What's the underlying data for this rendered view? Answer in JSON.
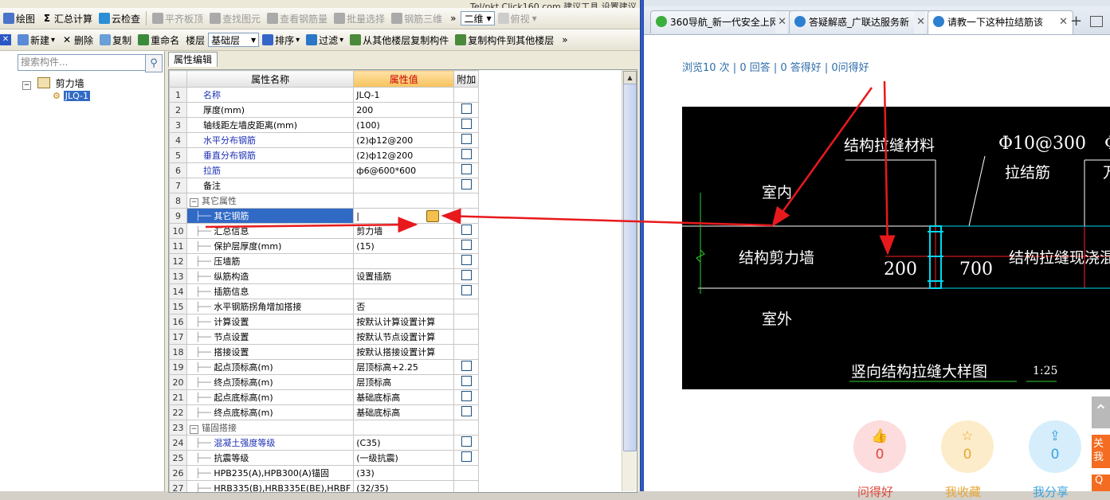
{
  "top_strip": {
    "text": "Tel/pkt.Click160.com    建议工具    设置建议"
  },
  "toolbar1": {
    "items": [
      {
        "label": "绘图",
        "enabled": true,
        "icon": "draw-icon"
      },
      {
        "label": "汇总计算",
        "enabled": true,
        "icon": "sigma-icon",
        "prefix": "Σ"
      },
      {
        "label": "云检查",
        "enabled": true,
        "icon": "cloud-check-icon"
      },
      {
        "label": "平齐板顶",
        "enabled": false,
        "icon": "align-top-icon"
      },
      {
        "label": "查找图元",
        "enabled": false,
        "icon": "find-element-icon"
      },
      {
        "label": "查看钢筋量",
        "enabled": false,
        "icon": "view-rebar-icon"
      },
      {
        "label": "批量选择",
        "enabled": false,
        "icon": "batch-select-icon"
      },
      {
        "label": "钢筋三维",
        "enabled": false,
        "icon": "rebar-3d-icon"
      }
    ],
    "overflow": "»",
    "view_combo": "二维",
    "view_combo2": "俯视"
  },
  "toolbar2": {
    "items": [
      {
        "label": "新建",
        "dropdown": true,
        "icon": "new-icon"
      },
      {
        "label": "删除",
        "icon": "delete-icon",
        "prefix": "✕"
      },
      {
        "label": "复制",
        "icon": "copy-icon"
      },
      {
        "label": "重命名",
        "icon": "rename-icon"
      }
    ],
    "floor_label": "楼层",
    "floor_value": "基础层",
    "items2": [
      {
        "label": "排序",
        "dropdown": true,
        "icon": "sort-icon"
      },
      {
        "label": "过滤",
        "dropdown": true,
        "icon": "filter-icon"
      },
      {
        "label": "从其他楼层复制构件",
        "icon": "copy-from-floor-icon"
      },
      {
        "label": "复制构件到其他楼层",
        "icon": "copy-to-floor-icon"
      }
    ],
    "overflow": "»"
  },
  "tree": {
    "search_placeholder": "搜索构件...",
    "root": "剪力墙",
    "child": "JLQ-1"
  },
  "tab_label": "属性编辑",
  "grid": {
    "headers": {
      "name": "属性名称",
      "value": "属性值",
      "attach": "附加"
    },
    "rows": [
      {
        "n": "1",
        "name": "名称",
        "value": "JLQ-1",
        "style": "blue",
        "chk": false
      },
      {
        "n": "2",
        "name": "厚度(mm)",
        "value": "200",
        "style": "",
        "chk": true
      },
      {
        "n": "3",
        "name": "轴线距左墙皮距离(mm)",
        "value": "(100)",
        "style": "",
        "chk": true
      },
      {
        "n": "4",
        "name": "水平分布钢筋",
        "value": "(2)ф12@200",
        "style": "blue",
        "chk": true
      },
      {
        "n": "5",
        "name": "垂直分布钢筋",
        "value": "(2)ф12@200",
        "style": "blue",
        "chk": true
      },
      {
        "n": "6",
        "name": "拉筋",
        "value": "ф6@600*600",
        "style": "blue",
        "chk": true
      },
      {
        "n": "7",
        "name": "备注",
        "value": "",
        "style": "",
        "chk": true
      },
      {
        "n": "8",
        "name": "其它属性",
        "value": "",
        "style": "group",
        "chk": false,
        "group": true
      },
      {
        "n": "9",
        "name": "其它钢筋",
        "value": "|",
        "style": "sel",
        "chk": false,
        "child": true,
        "ellipsis": true
      },
      {
        "n": "10",
        "name": "汇总信息",
        "value": "剪力墙",
        "style": "",
        "chk": true,
        "child": true
      },
      {
        "n": "11",
        "name": "保护层厚度(mm)",
        "value": "(15)",
        "style": "",
        "chk": true,
        "child": true
      },
      {
        "n": "12",
        "name": "压墙筋",
        "value": "",
        "style": "",
        "chk": true,
        "child": true
      },
      {
        "n": "13",
        "name": "纵筋构造",
        "value": "设置插筋",
        "style": "",
        "chk": true,
        "child": true
      },
      {
        "n": "14",
        "name": "插筋信息",
        "value": "",
        "style": "",
        "chk": true,
        "child": true
      },
      {
        "n": "15",
        "name": "水平钢筋拐角增加搭接",
        "value": "否",
        "style": "",
        "chk": false,
        "child": true
      },
      {
        "n": "16",
        "name": "计算设置",
        "value": "按默认计算设置计算",
        "style": "",
        "chk": false,
        "child": true
      },
      {
        "n": "17",
        "name": "节点设置",
        "value": "按默认节点设置计算",
        "style": "",
        "chk": false,
        "child": true
      },
      {
        "n": "18",
        "name": "搭接设置",
        "value": "按默认搭接设置计算",
        "style": "",
        "chk": false,
        "child": true
      },
      {
        "n": "19",
        "name": "起点顶标高(m)",
        "value": "层顶标高+2.25",
        "style": "",
        "chk": true,
        "child": true
      },
      {
        "n": "20",
        "name": "终点顶标高(m)",
        "value": "层顶标高",
        "style": "",
        "chk": true,
        "child": true
      },
      {
        "n": "21",
        "name": "起点底标高(m)",
        "value": "基础底标高",
        "style": "",
        "chk": true,
        "child": true
      },
      {
        "n": "22",
        "name": "终点底标高(m)",
        "value": "基础底标高",
        "style": "",
        "chk": true,
        "child": true
      },
      {
        "n": "23",
        "name": "锚固搭接",
        "value": "",
        "style": "group",
        "chk": false,
        "group": true
      },
      {
        "n": "24",
        "name": "混凝土强度等级",
        "value": "(C35)",
        "style": "blue",
        "chk": true,
        "child": true
      },
      {
        "n": "25",
        "name": "抗震等级",
        "value": "(一级抗震)",
        "style": "",
        "chk": true,
        "child": true
      },
      {
        "n": "26",
        "name": "HPB235(A),HPB300(A)锚固",
        "value": "(33)",
        "style": "",
        "chk": false,
        "child": true
      },
      {
        "n": "27",
        "name": "HRB335(B),HRB335E(BE),HRBF",
        "value": "(32/35)",
        "style": "",
        "chk": false,
        "child": true
      }
    ]
  },
  "browser": {
    "tabs": [
      {
        "label": "360导航_新一代安全上网",
        "active": false,
        "icon": "globe-360-icon"
      },
      {
        "label": "答疑解惑_广联达服务新",
        "active": false,
        "icon": "ie-icon"
      },
      {
        "label": "请教一下这种拉结筋该",
        "active": true,
        "icon": "ie-icon"
      }
    ],
    "new_tab": "+",
    "stats": "浏览10 次 | 0 回答 | 0 答得好 | 0问得好",
    "cad": {
      "material": "结构拉缝材料",
      "rebar_spec": "Φ10@300",
      "rebar_spec_cut": "Φ",
      "tie_bar": "拉结筋",
      "tie_bar_cut": "万",
      "indoor": "室内",
      "wall": "结构剪力墙",
      "dim_200": "200",
      "dim_700": "700",
      "seam_concrete": "结构拉缝现浇混凝土填充",
      "outdoor": "室外",
      "caption": "竖向结构拉缝大样图",
      "scale": "1:25"
    },
    "actions": [
      {
        "glyph": "👍",
        "count": "0",
        "label": "问得好",
        "color": "#fcdcdc",
        "fg": "#e0483c"
      },
      {
        "glyph": "☆",
        "count": "0",
        "label": "我收藏",
        "color": "#fdecc9",
        "fg": "#e7a735"
      },
      {
        "glyph": "⇪",
        "count": "0",
        "label": "我分享",
        "color": "#d6eefb",
        "fg": "#3aa3df"
      }
    ],
    "side": {
      "top_glyph": "⌃",
      "follow1": "关",
      "follow2": "我",
      "q": "Q"
    }
  }
}
